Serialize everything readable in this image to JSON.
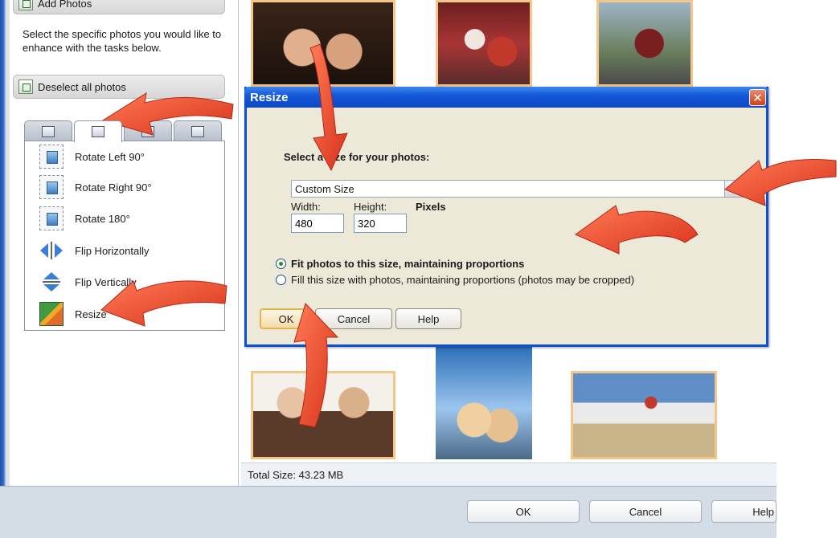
{
  "left_panel": {
    "add_photos_label": "Add Photos",
    "instructions": "Select the specific photos you would like to enhance with the tasks below.",
    "deselect_label": "Deselect all photos",
    "tasks": [
      {
        "label": "Rotate Left 90°",
        "icon": "rotate-left-icon"
      },
      {
        "label": "Rotate Right 90°",
        "icon": "rotate-right-icon"
      },
      {
        "label": "Rotate 180°",
        "icon": "rotate-180-icon"
      },
      {
        "label": "Flip Horizontally",
        "icon": "flip-horizontal-icon"
      },
      {
        "label": "Flip Vertically",
        "icon": "flip-vertical-icon"
      },
      {
        "label": "Resize",
        "icon": "resize-icon"
      }
    ]
  },
  "status": {
    "total_size": "Total Size: 43.23 MB"
  },
  "footer": {
    "ok_label": "OK",
    "cancel_label": "Cancel",
    "help_label": "Help"
  },
  "dialog": {
    "title": "Resize",
    "close_glyph": "✕",
    "prompt": "Select a size for your photos:",
    "preset_value": "Custom Size",
    "width_label": "Width:",
    "height_label": "Height:",
    "units": "Pixels",
    "width_value": "480",
    "height_value": "320",
    "option_fit": "Fit photos to this size, maintaining proportions",
    "option_fill": "Fill this size with photos, maintaining proportions (photos may be cropped)",
    "selected_option": "fit",
    "ok_label": "OK",
    "cancel_label": "Cancel",
    "help_label": "Help"
  },
  "colors": {
    "annotation_arrow": "#e8432a",
    "dialog_title": "#1459d8",
    "photo_border": "#f3c68a"
  }
}
